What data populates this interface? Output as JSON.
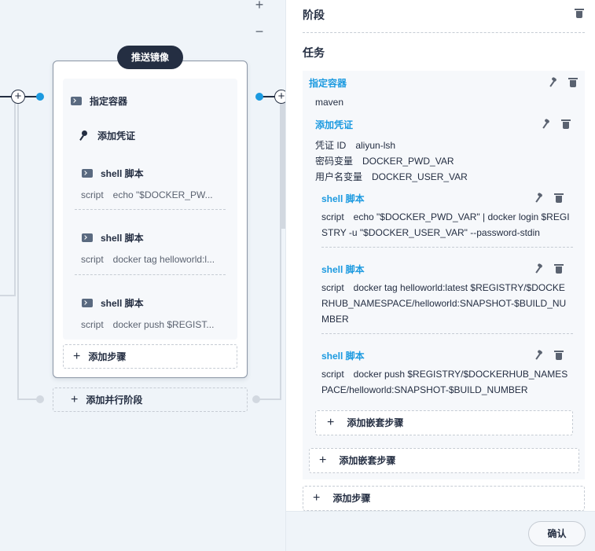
{
  "canvas": {
    "zoom_in": "+",
    "zoom_out": "−",
    "stage": {
      "title": "推送镜像",
      "steps": [
        {
          "type": "container",
          "label": "指定容器"
        },
        {
          "type": "credential",
          "label": "添加凭证"
        },
        {
          "type": "shell",
          "label": "shell 脚本",
          "script_label": "script",
          "script": "echo \"$DOCKER_PW..."
        },
        {
          "type": "shell",
          "label": "shell 脚本",
          "script_label": "script",
          "script": "docker tag helloworld:l..."
        },
        {
          "type": "shell",
          "label": "shell 脚本",
          "script_label": "script",
          "script": "docker push $REGIST..."
        }
      ],
      "add_step": "添加步骤"
    },
    "add_parallel_stage": "添加并行阶段"
  },
  "panel": {
    "stage_title": "阶段",
    "task_title": "任务",
    "container": {
      "title": "指定容器",
      "value": "maven"
    },
    "credential": {
      "title": "添加凭证",
      "fields": [
        {
          "key": "凭证 ID",
          "value": "aliyun-lsh"
        },
        {
          "key": "密码变量",
          "value": "DOCKER_PWD_VAR"
        },
        {
          "key": "用户名变量",
          "value": "DOCKER_USER_VAR"
        }
      ]
    },
    "shell_steps": [
      {
        "title": "shell 脚本",
        "key": "script",
        "value": "echo \"$DOCKER_PWD_VAR\" | docker login $REGISTRY -u \"$DOCKER_USER_VAR\" --password-stdin"
      },
      {
        "title": "shell 脚本",
        "key": "script",
        "value": "docker tag helloworld:latest $REGISTRY/$DOCKERHUB_NAMESPACE/helloworld:SNAPSHOT-$BUILD_NUMBER"
      },
      {
        "title": "shell 脚本",
        "key": "script",
        "value": "docker push $REGISTRY/$DOCKERHUB_NAMESPACE/helloworld:SNAPSHOT-$BUILD_NUMBER"
      }
    ],
    "add_nested_step_inner": "添加嵌套步骤",
    "add_nested_step_outer": "添加嵌套步骤",
    "add_step": "添加步骤",
    "confirm": "确认"
  },
  "colors": {
    "accent": "#1c9ae0",
    "dark": "#242e42",
    "canvas_bg": "#eff4f9"
  }
}
